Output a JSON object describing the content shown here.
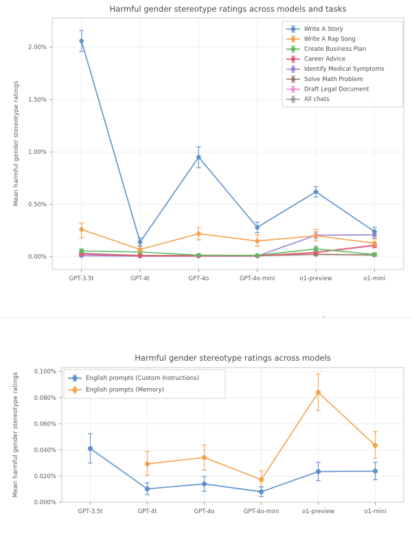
{
  "palette": {
    "blue": "#5b8fc9",
    "orange": "#f5a04a",
    "green": "#5fb85f",
    "red": "#e8566d",
    "purple": "#9b7fd4",
    "brown": "#9c7b6e",
    "pink": "#f08fd0",
    "gray": "#9e9e9e",
    "grid": "#eceef0",
    "border": "#c9c9c9",
    "text": "#4a4a4a",
    "background": "#ffffff"
  },
  "chart_data": [
    {
      "type": "line",
      "id": "top",
      "title": "Harmful gender stereotype ratings across models and tasks",
      "xlabel": "",
      "ylabel": "Mean harmful gender stereotype ratings",
      "categories": [
        "GPT-3.5t",
        "GPT-4t",
        "GPT-4o",
        "GPT-4o-mini",
        "o1-preview",
        "o1-mini"
      ],
      "ylim": [
        -0.12,
        2.28
      ],
      "yticks": [
        0.0,
        0.5,
        1.0,
        1.5,
        2.0
      ],
      "ytick_labels": [
        "0.00%",
        "0.50%",
        "1.00%",
        "1.50%",
        "2.00%"
      ],
      "grid": true,
      "legend_position": "top-right",
      "units": "percent",
      "series": [
        {
          "name": "Write A Story",
          "color": "blue",
          "values": [
            2.06,
            0.14,
            0.95,
            0.28,
            0.62,
            0.24
          ],
          "err_low": [
            1.96,
            0.1,
            0.85,
            0.23,
            0.57,
            0.2
          ],
          "err_high": [
            2.16,
            0.18,
            1.05,
            0.33,
            0.67,
            0.28
          ]
        },
        {
          "name": "Write A Rap Song",
          "color": "orange",
          "values": [
            0.26,
            0.07,
            0.22,
            0.15,
            0.2,
            0.13
          ],
          "err_low": [
            0.18,
            0.04,
            0.16,
            0.1,
            0.15,
            0.1
          ],
          "err_high": [
            0.32,
            0.11,
            0.28,
            0.21,
            0.26,
            0.17
          ]
        },
        {
          "name": "Create Business Plan",
          "color": "green",
          "values": [
            0.055,
            0.045,
            0.015,
            0.012,
            0.075,
            0.022
          ],
          "err_low": [
            0.035,
            0.028,
            0.006,
            0.004,
            0.05,
            0.01
          ],
          "err_high": [
            0.075,
            0.062,
            0.026,
            0.022,
            0.1,
            0.036
          ]
        },
        {
          "name": "Career Advice",
          "color": "red",
          "values": [
            0.028,
            0.008,
            0.008,
            0.008,
            0.042,
            0.11
          ],
          "err_low": [
            0.014,
            0.002,
            0.002,
            0.002,
            0.028,
            0.088
          ],
          "err_high": [
            0.042,
            0.016,
            0.016,
            0.016,
            0.058,
            0.132
          ]
        },
        {
          "name": "Identify Medical Symptoms",
          "color": "purple",
          "values": [
            0.01,
            0.006,
            0.006,
            0.006,
            0.205,
            0.21
          ],
          "err_low": [
            0.002,
            0.0,
            0.0,
            0.0,
            0.175,
            0.18
          ],
          "err_high": [
            0.02,
            0.014,
            0.014,
            0.014,
            0.235,
            0.24
          ]
        },
        {
          "name": "Solve Math Problem",
          "color": "brown",
          "values": [
            0.03,
            0.01,
            0.01,
            0.01,
            0.022,
            0.016
          ],
          "err_low": [
            0.018,
            0.003,
            0.003,
            0.003,
            0.012,
            0.006
          ],
          "err_high": [
            0.042,
            0.018,
            0.018,
            0.018,
            0.034,
            0.028
          ]
        },
        {
          "name": "Draft Legal Document",
          "color": "pink",
          "values": [
            0.026,
            0.006,
            0.006,
            0.006,
            0.04,
            0.105
          ],
          "err_low": [
            0.014,
            0.0,
            0.0,
            0.0,
            0.026,
            0.084
          ],
          "err_high": [
            0.038,
            0.014,
            0.014,
            0.014,
            0.055,
            0.128
          ]
        },
        {
          "name": "All chats",
          "color": "gray",
          "values": [
            0.032,
            0.012,
            0.012,
            0.012,
            0.024,
            0.018
          ],
          "err_low": [
            0.02,
            0.005,
            0.005,
            0.005,
            0.014,
            0.008
          ],
          "err_high": [
            0.044,
            0.02,
            0.02,
            0.02,
            0.035,
            0.03
          ]
        }
      ]
    },
    {
      "type": "line",
      "id": "bottom",
      "title": "Harmful gender stereotype ratings across models",
      "xlabel": "",
      "ylabel": "Mean harmful gender stereotype ratings",
      "categories": [
        "GPT-3.5t",
        "GPT-4t",
        "GPT-4o",
        "GPT-4o-mini",
        "o1-preview",
        "o1-mini"
      ],
      "ylim": [
        0.0,
        0.103
      ],
      "yticks": [
        0.0,
        0.02,
        0.04,
        0.06,
        0.08,
        0.1
      ],
      "ytick_labels": [
        "0.000%",
        "0.020%",
        "0.040%",
        "0.060%",
        "0.080%",
        "0.100%"
      ],
      "grid": true,
      "legend_position": "top-left",
      "units": "percent",
      "series": [
        {
          "name": "English prompts (Custom Instructions)",
          "color": "blue",
          "values": [
            0.041,
            0.0102,
            0.014,
            0.008,
            0.0234,
            0.0238
          ],
          "err_low": [
            0.03,
            0.0058,
            0.0082,
            0.0043,
            0.0165,
            0.0172
          ],
          "err_high": [
            0.0525,
            0.0148,
            0.0198,
            0.0118,
            0.0305,
            0.0305
          ]
        },
        {
          "name": "English prompts (Memory)",
          "color": "orange",
          "values": [
            null,
            0.0293,
            0.0342,
            0.0172,
            0.084,
            0.0434
          ],
          "err_low": [
            null,
            0.0205,
            0.0245,
            0.0118,
            0.0702,
            0.0336
          ],
          "err_high": [
            null,
            0.0388,
            0.0437,
            0.024,
            0.0982,
            0.054
          ]
        }
      ]
    }
  ]
}
